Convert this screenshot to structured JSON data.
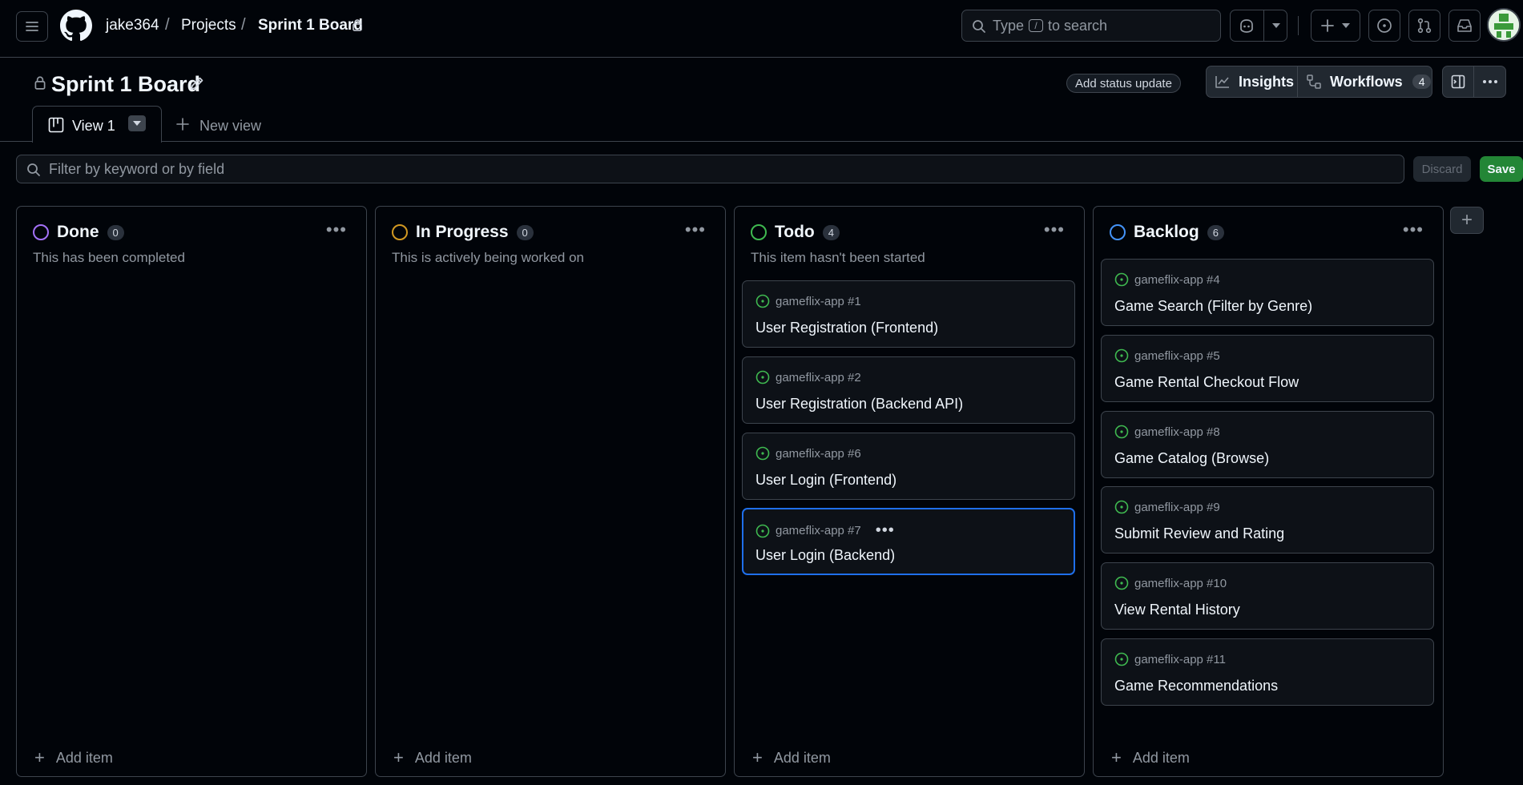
{
  "header": {
    "owner": "jake364",
    "projects": "Projects",
    "board": "Sprint 1 Board",
    "search": {
      "before": "Type",
      "key": "/",
      "after": "to search"
    }
  },
  "project": {
    "title": "Sprint 1 Board",
    "status_update": "Add status update",
    "insights": "Insights",
    "workflows": "Workflows",
    "workflows_count": "4"
  },
  "tabs": {
    "active": "View 1",
    "new_view": "New view"
  },
  "filter": {
    "placeholder": "Filter by keyword or by field",
    "discard": "Discard",
    "save": "Save"
  },
  "colors": {
    "done": "#a371f7",
    "in_progress": "#d29922",
    "todo": "#3fb950",
    "backlog": "#4493f8",
    "issue_open": "#3fb950"
  },
  "columns": [
    {
      "name": "Done",
      "count": "0",
      "desc": "This has been completed",
      "add": "Add item",
      "cards": []
    },
    {
      "name": "In Progress",
      "count": "0",
      "desc": "This is actively being worked on",
      "add": "Add item",
      "cards": []
    },
    {
      "name": "Todo",
      "count": "4",
      "desc": "This item hasn't been started",
      "add": "Add item",
      "cards": [
        {
          "meta": "gameflix-app #1",
          "title": "User Registration (Frontend)"
        },
        {
          "meta": "gameflix-app #2",
          "title": "User Registration (Backend API)"
        },
        {
          "meta": "gameflix-app #6",
          "title": "User Login (Frontend)"
        },
        {
          "meta": "gameflix-app #7",
          "title": "User Login (Backend)"
        }
      ]
    },
    {
      "name": "Backlog",
      "count": "6",
      "desc": "",
      "add": "Add item",
      "cards": [
        {
          "meta": "gameflix-app #4",
          "title": "Game Search (Filter by Genre)"
        },
        {
          "meta": "gameflix-app #5",
          "title": "Game Rental Checkout Flow"
        },
        {
          "meta": "gameflix-app #8",
          "title": "Game Catalog (Browse)"
        },
        {
          "meta": "gameflix-app #9",
          "title": "Submit Review and Rating"
        },
        {
          "meta": "gameflix-app #10",
          "title": "View Rental History"
        },
        {
          "meta": "gameflix-app #11",
          "title": "Game Recommendations"
        }
      ]
    }
  ]
}
